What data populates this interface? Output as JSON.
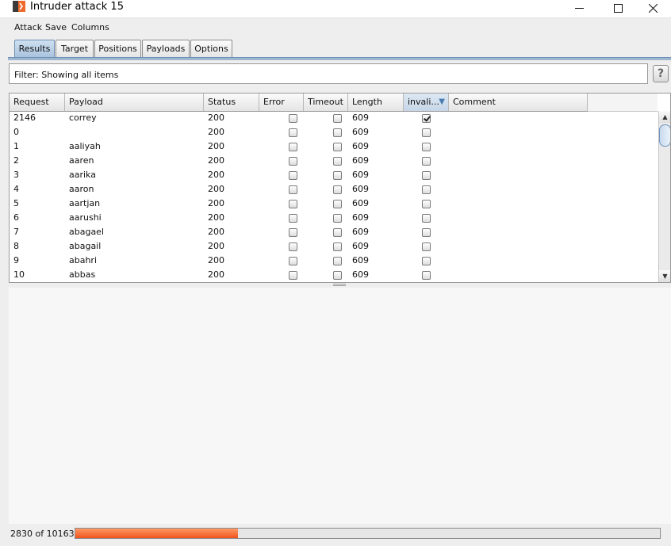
{
  "window": {
    "title": "Intruder attack 15"
  },
  "menu": [
    "Attack",
    "Save",
    "Columns"
  ],
  "tabs": [
    {
      "label": "Results",
      "active": true
    },
    {
      "label": "Target",
      "active": false
    },
    {
      "label": "Positions",
      "active": false
    },
    {
      "label": "Payloads",
      "active": false
    },
    {
      "label": "Options",
      "active": false
    }
  ],
  "filter": {
    "text": "Filter:  Showing all items"
  },
  "help": {
    "label": "?"
  },
  "table": {
    "columns": [
      "Request",
      "Payload",
      "Status",
      "Error",
      "Timeout",
      "Length",
      "invali...",
      "Comment"
    ],
    "sorted_column": "invali...",
    "rows": [
      {
        "request": "2146",
        "payload": "correy",
        "status": "200",
        "error": false,
        "timeout": false,
        "length": "609",
        "invalid": true,
        "comment": ""
      },
      {
        "request": "0",
        "payload": "",
        "status": "200",
        "error": false,
        "timeout": false,
        "length": "609",
        "invalid": false,
        "comment": ""
      },
      {
        "request": "1",
        "payload": "aaliyah",
        "status": "200",
        "error": false,
        "timeout": false,
        "length": "609",
        "invalid": false,
        "comment": ""
      },
      {
        "request": "2",
        "payload": "aaren",
        "status": "200",
        "error": false,
        "timeout": false,
        "length": "609",
        "invalid": false,
        "comment": ""
      },
      {
        "request": "3",
        "payload": "aarika",
        "status": "200",
        "error": false,
        "timeout": false,
        "length": "609",
        "invalid": false,
        "comment": ""
      },
      {
        "request": "4",
        "payload": "aaron",
        "status": "200",
        "error": false,
        "timeout": false,
        "length": "609",
        "invalid": false,
        "comment": ""
      },
      {
        "request": "5",
        "payload": "aartjan",
        "status": "200",
        "error": false,
        "timeout": false,
        "length": "609",
        "invalid": false,
        "comment": ""
      },
      {
        "request": "6",
        "payload": "aarushi",
        "status": "200",
        "error": false,
        "timeout": false,
        "length": "609",
        "invalid": false,
        "comment": ""
      },
      {
        "request": "7",
        "payload": "abagael",
        "status": "200",
        "error": false,
        "timeout": false,
        "length": "609",
        "invalid": false,
        "comment": ""
      },
      {
        "request": "8",
        "payload": "abagail",
        "status": "200",
        "error": false,
        "timeout": false,
        "length": "609",
        "invalid": false,
        "comment": ""
      },
      {
        "request": "9",
        "payload": "abahri",
        "status": "200",
        "error": false,
        "timeout": false,
        "length": "609",
        "invalid": false,
        "comment": ""
      },
      {
        "request": "10",
        "payload": "abbas",
        "status": "200",
        "error": false,
        "timeout": false,
        "length": "609",
        "invalid": false,
        "comment": ""
      }
    ]
  },
  "progress": {
    "label": "2830 of 10163",
    "done": 2830,
    "total": 10163
  },
  "colors": {
    "accent": "#f0531d",
    "tab_active": "#a9c3de",
    "selection": "#4a7bb0"
  },
  "icons": [
    "burp-app-icon",
    "minimize-icon",
    "maximize-icon",
    "close-icon",
    "help-icon",
    "sort-desc-icon",
    "scroll-up-icon",
    "scroll-down-icon",
    "checkbox-icon"
  ]
}
